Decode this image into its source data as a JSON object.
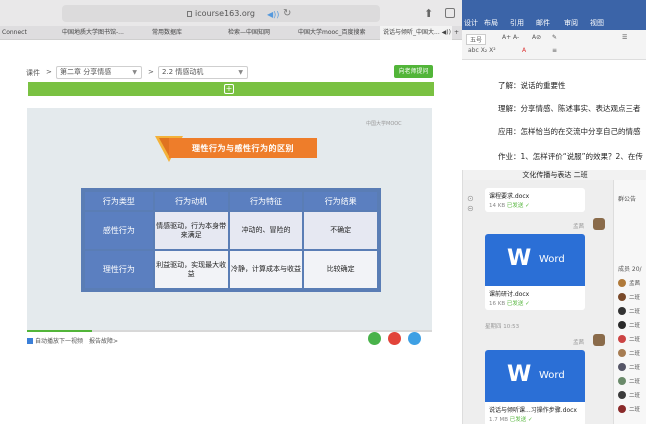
{
  "browser": {
    "address": "icourse163.org",
    "tabs": [
      "Connect",
      "中国地质大学图书馆-...",
      "常用数据库",
      "检索—中国知网",
      "中国大学mooc_百度搜索",
      "说话与倾听_中国大... ◀))",
      "+"
    ]
  },
  "course_page": {
    "crumb_prefix": "课件",
    "crumb_sep": ">",
    "chapter": "第二章 分享情感",
    "lesson": "2.2 情感动机",
    "ask_button": "向老师提问",
    "expand_symbol": "+",
    "video": {
      "watermark": "中国大学MOOC",
      "banner": "理性行为与感性行为的区别",
      "table": {
        "headers": [
          "行为类型",
          "行为动机",
          "行为特征",
          "行为结果"
        ],
        "rows": [
          [
            "感性行为",
            "情感驱动，行为本身带来满足",
            "冲动的、冒险的",
            "不确定"
          ],
          [
            "理性行为",
            "利益驱动，实现最大收益",
            "冷静，计算成本与收益",
            "比较确定"
          ]
        ]
      },
      "progress": 0.16
    },
    "autoplay_label": "自动播放下一视频",
    "report_link": "报告故障>"
  },
  "word": {
    "tabs": [
      "设计",
      "布局",
      "引用",
      "邮件",
      "审阅",
      "视图"
    ],
    "font_size": "五号",
    "lines": [
      "了解：说话的重要性",
      "理解：分享情感、陈述事实、表达观点三者",
      "应用：怎样恰当的在交流中分享自己的情感",
      "作业：1、怎样评价“说服”的效果？2、在传"
    ]
  },
  "chat": {
    "title": "文化传播与表达 二班",
    "group_label": "群公告",
    "members_label": "成员 20/",
    "files": [
      {
        "name": "课程要求.docx",
        "size": "14 KB",
        "status": "已发送"
      },
      {
        "name": "课前研讨.docx",
        "size": "16 KB",
        "status": "已发送",
        "brand": "Word",
        "letter": "W"
      },
      {
        "name": "说话与倾听课...习操作步骤.docx",
        "size": "1.7 MB",
        "status": "已发送",
        "brand": "Word",
        "letter": "W"
      }
    ],
    "sender": "孟茜",
    "time": "星期四 10:53",
    "members": [
      "孟茜",
      "二班",
      "二班",
      "二班",
      "二班",
      "二班",
      "二班",
      "二班",
      "二班",
      "二班"
    ]
  }
}
